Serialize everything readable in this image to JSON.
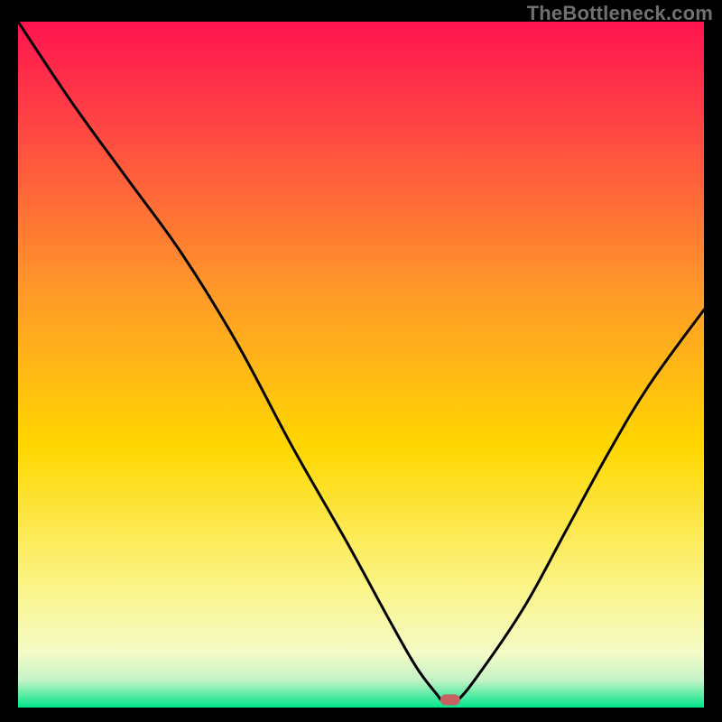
{
  "watermark": "TheBottleneck.com",
  "chart_data": {
    "type": "line",
    "title": "",
    "xlabel": "",
    "ylabel": "",
    "xlim": [
      0,
      100
    ],
    "ylim": [
      0,
      100
    ],
    "grid": false,
    "background_gradient": {
      "top_color": "#ff1450",
      "mid_color": "#ffd700",
      "bottom_color": "#00e58a"
    },
    "series": [
      {
        "name": "bottleneck-curve",
        "x": [
          0,
          8,
          16,
          24,
          32,
          40,
          48,
          54,
          58,
          61,
          62,
          64,
          68,
          74,
          80,
          86,
          92,
          100
        ],
        "values": [
          100,
          88,
          77,
          66,
          53,
          38,
          24,
          13,
          6,
          2,
          1,
          1,
          6,
          15,
          26,
          37,
          47,
          58
        ]
      }
    ],
    "marker": {
      "name": "optimum-point",
      "x": 63,
      "y": 1,
      "color": "#c86262",
      "shape": "rounded-pill"
    }
  }
}
